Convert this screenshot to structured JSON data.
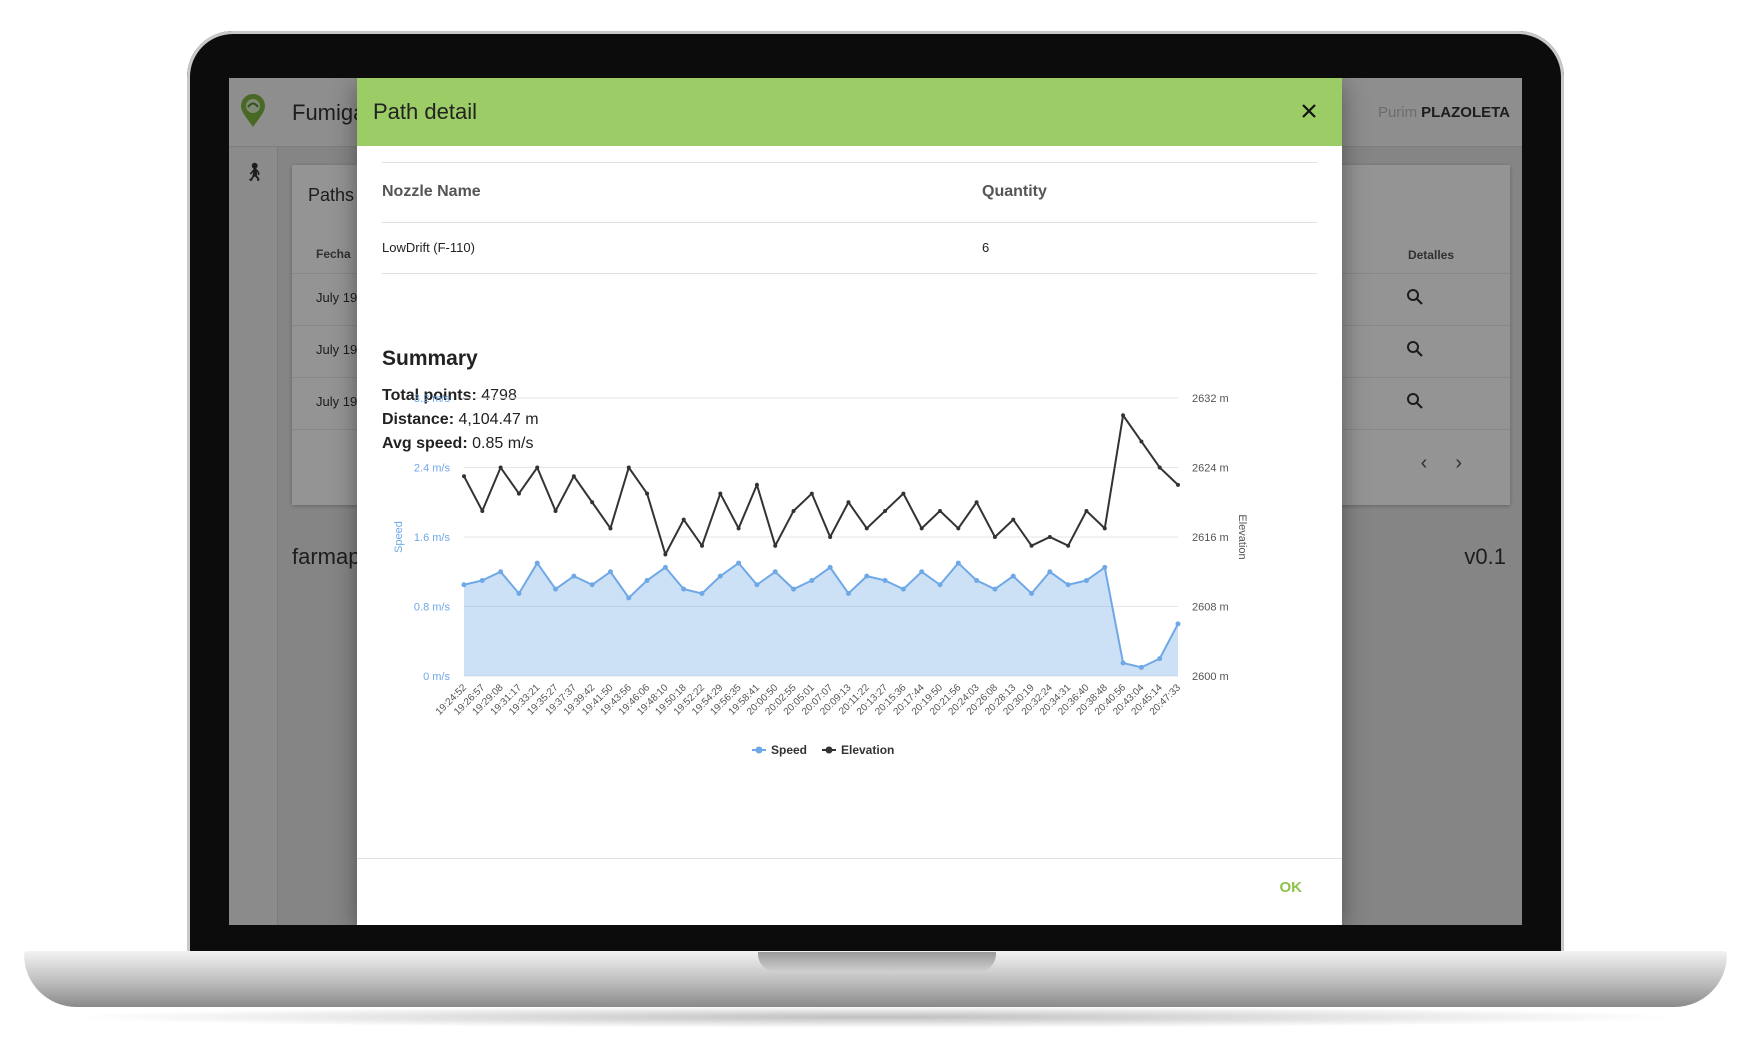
{
  "app": {
    "title": "Fumiga",
    "brand_faded": "Purim",
    "brand": "PLAZOLETA",
    "footer_left": "farmap",
    "version": "v0.1"
  },
  "paths_card": {
    "title": "Paths",
    "col_date": "Fecha",
    "col_details": "Detalles",
    "rows": [
      {
        "date": "July 19"
      },
      {
        "date": "July 19"
      },
      {
        "date": "July 19"
      }
    ]
  },
  "dialog": {
    "title": "Path detail",
    "table": {
      "col_name": "Nozzle Name",
      "col_quantity": "Quantity",
      "rows": [
        {
          "name": "LowDrift (F-110)",
          "quantity": "6"
        }
      ]
    },
    "summary": {
      "title": "Summary",
      "total_points_label": "Total points:",
      "total_points": "4798",
      "distance_label": "Distance:",
      "distance": "4,104.47 m",
      "avg_speed_label": "Avg speed:",
      "avg_speed": "0.85 m/s"
    },
    "ok_label": "OK"
  },
  "colors": {
    "header_green": "#9ccc65",
    "ok_green": "#8bc34a",
    "speed_blue": "#6fa8e6",
    "elevation_dark": "#333333"
  },
  "chart_data": {
    "type": "line",
    "y_left_label": "Speed",
    "y_right_label": "Elevation",
    "y_left_ticks": [
      "0 m/s",
      "0.8 m/s",
      "1.6 m/s",
      "2.4 m/s",
      "3.2 m/s"
    ],
    "y_right_ticks": [
      "2600 m",
      "2608 m",
      "2616 m",
      "2624 m",
      "2632 m"
    ],
    "ylim_left": [
      0,
      3.2
    ],
    "ylim_right": [
      2600,
      2632
    ],
    "grid": true,
    "legend_position": "bottom",
    "x": [
      "19:24:52",
      "19:26:57",
      "19:29:08",
      "19:31:17",
      "19:33:21",
      "19:35:27",
      "19:37:37",
      "19:39:42",
      "19:41:50",
      "19:43:56",
      "19:46:06",
      "19:48:10",
      "19:50:18",
      "19:52:22",
      "19:54:29",
      "19:56:35",
      "19:58:41",
      "20:00:50",
      "20:02:55",
      "20:05:01",
      "20:07:07",
      "20:09:13",
      "20:11:22",
      "20:13:27",
      "20:15:36",
      "20:17:44",
      "20:19:50",
      "20:21:56",
      "20:24:03",
      "20:26:08",
      "20:28:13",
      "20:30:19",
      "20:32:24",
      "20:34:31",
      "20:36:40",
      "20:38:48",
      "20:40:56",
      "20:43:04",
      "20:45:14",
      "20:47:33"
    ],
    "series": [
      {
        "name": "Speed",
        "values": [
          1.05,
          1.1,
          1.2,
          0.95,
          1.3,
          1.0,
          1.15,
          1.05,
          1.2,
          0.9,
          1.1,
          1.25,
          1.0,
          0.95,
          1.15,
          1.3,
          1.05,
          1.2,
          1.0,
          1.1,
          1.25,
          0.95,
          1.15,
          1.1,
          1.0,
          1.2,
          1.05,
          1.3,
          1.1,
          1.0,
          1.15,
          0.95,
          1.2,
          1.05,
          1.1,
          1.25,
          0.15,
          0.1,
          0.2,
          0.6
        ]
      },
      {
        "name": "Elevation",
        "values": [
          2623,
          2619,
          2624,
          2621,
          2624,
          2619,
          2623,
          2620,
          2617,
          2624,
          2621,
          2614,
          2618,
          2615,
          2621,
          2617,
          2622,
          2615,
          2619,
          2621,
          2616,
          2620,
          2617,
          2619,
          2621,
          2617,
          2619,
          2617,
          2620,
          2616,
          2618,
          2615,
          2616,
          2615,
          2619,
          2617,
          2630,
          2627,
          2624,
          2622
        ]
      }
    ]
  }
}
